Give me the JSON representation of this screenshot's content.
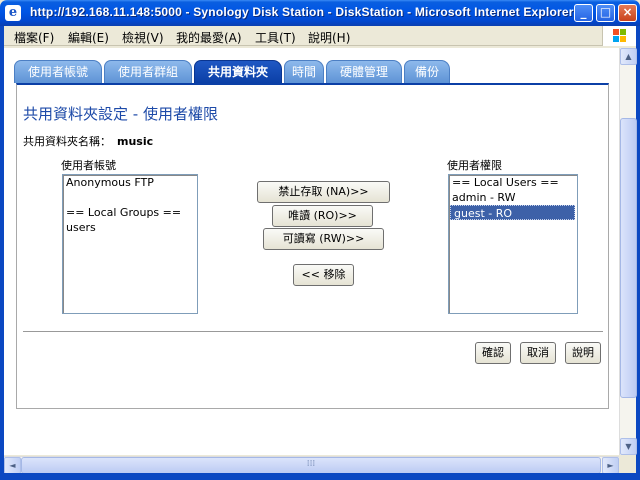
{
  "window": {
    "title": "http://192.168.11.148:5000 - Synology Disk Station - DiskStation - Microsoft Internet Explorer",
    "icon": "ie-icon",
    "minimize": "_",
    "maximize": "□",
    "close": "×"
  },
  "menu": {
    "items": [
      "檔案(F)",
      "編輯(E)",
      "檢視(V)",
      "我的最愛(A)",
      "工具(T)",
      "說明(H)"
    ]
  },
  "tabs": [
    {
      "label": "使用者帳號",
      "active": false
    },
    {
      "label": "使用者群組",
      "active": false
    },
    {
      "label": "共用資料夾",
      "active": true
    },
    {
      "label": "時間",
      "active": false
    },
    {
      "label": "硬體管理",
      "active": false
    },
    {
      "label": "備份",
      "active": false
    }
  ],
  "page": {
    "heading": "共用資料夾設定 - 使用者權限",
    "share_label": "共用資料夾名稱：",
    "share_name": "music",
    "left_list": {
      "title": "使用者帳號",
      "options": [
        "Anonymous FTP",
        "",
        "== Local Groups ==",
        "users"
      ]
    },
    "right_list": {
      "title": "使用者權限",
      "options": [
        "== Local Users ==",
        "admin - RW",
        "guest - RO"
      ],
      "selected_index": 2
    },
    "buttons": {
      "no_access": "禁止存取 (NA)>>",
      "read_only": "唯讀 (RO)>>",
      "read_write": "可讀寫 (RW)>>",
      "remove": "<< 移除"
    },
    "footer_buttons": {
      "ok": "確認",
      "cancel": "取消",
      "help": "說明"
    }
  },
  "scrollbar": {
    "up": "▲",
    "down": "▼",
    "left": "◄",
    "right": "►",
    "grip": "⁞⁞⁞"
  },
  "colors": {
    "titlebar": "#0055e5",
    "tab_active": "#0b3fa6",
    "tab_inactive": "#6fa0de",
    "heading": "#1d4aa8",
    "selection": "#3d61a8"
  }
}
